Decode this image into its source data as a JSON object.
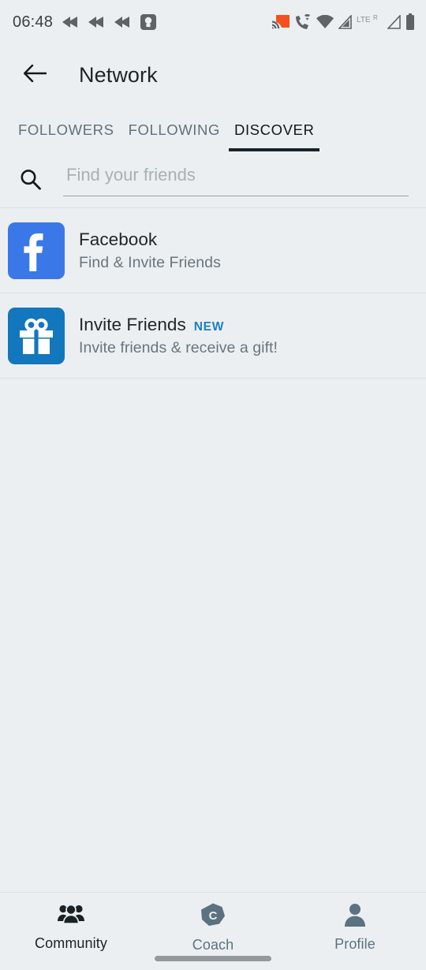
{
  "status_bar": {
    "clock": "06:48",
    "left_icons": [
      "rewind-arrow-icon",
      "rewind-arrow-icon",
      "rewind-arrow-icon",
      "app-badge-icon"
    ],
    "right_icons": [
      "cast-icon",
      "phone-wifi-calling-icon",
      "wifi-icon",
      "signal-icon",
      "lte-roaming-icon",
      "signal-icon",
      "battery-icon"
    ],
    "lte_label": "LTE",
    "roaming_label": "R",
    "accent_cast_color": "#f4511e"
  },
  "app_bar": {
    "back_icon": "arrow-left-icon",
    "title": "Network"
  },
  "tabs": {
    "items": [
      {
        "label": "FOLLOWERS",
        "active": false
      },
      {
        "label": "FOLLOWING",
        "active": false
      },
      {
        "label": "DISCOVER",
        "active": true
      }
    ],
    "indicator_color": "#18222a"
  },
  "search": {
    "icon": "search-icon",
    "value": "",
    "placeholder": "Find your friends"
  },
  "list": {
    "rows": [
      {
        "icon": "facebook-icon",
        "tile_color": "#3b78e7",
        "title": "Facebook",
        "badge": "",
        "subtitle": "Find & Invite Friends"
      },
      {
        "icon": "gift-icon",
        "tile_color": "#1277bc",
        "title": "Invite Friends",
        "badge": "NEW",
        "subtitle": "Invite friends & receive a gift!"
      }
    ]
  },
  "bottom_nav": {
    "items": [
      {
        "label": "Community",
        "icon": "people-group-icon",
        "active": true
      },
      {
        "label": "Coach",
        "icon": "coach-heptagon-c-icon",
        "active": false
      },
      {
        "label": "Profile",
        "icon": "person-icon",
        "active": false
      }
    ],
    "active_color": "#1b2226",
    "inactive_color": "#5c7280"
  }
}
